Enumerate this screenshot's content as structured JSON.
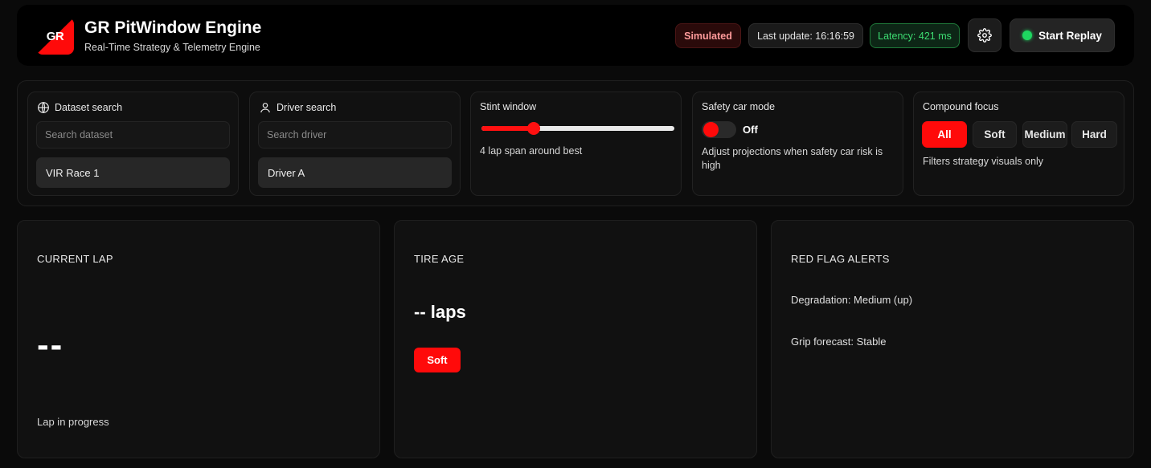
{
  "header": {
    "logo_text": "GR",
    "title": "GR PitWindow Engine",
    "subtitle": "Real-Time Strategy & Telemetry Engine",
    "mode_badge": "Simulated",
    "last_update": "Last update: 16:16:59",
    "latency": "Latency: 421 ms",
    "replay_label": "Start Replay"
  },
  "controls": {
    "dataset": {
      "label": "Dataset search",
      "placeholder": "Search dataset",
      "selected": "VIR Race 1"
    },
    "driver": {
      "label": "Driver search",
      "placeholder": "Search driver",
      "selected": "Driver A"
    },
    "stint": {
      "label": "Stint window",
      "slider_fraction": 0.27,
      "note": "4 lap span around best"
    },
    "safety_car": {
      "label": "Safety car mode",
      "state": "Off",
      "note": "Adjust projections when safety car risk is high"
    },
    "compound": {
      "label": "Compound focus",
      "options": [
        "All",
        "Soft",
        "Medium",
        "Hard"
      ],
      "active": "All",
      "note": "Filters strategy visuals only"
    }
  },
  "cards": {
    "current_lap": {
      "title": "CURRENT LAP",
      "value": "--",
      "footer": "Lap in progress"
    },
    "tire_age": {
      "title": "TIRE AGE",
      "value": "-- laps",
      "compound": "Soft"
    },
    "alerts": {
      "title": "RED FLAG ALERTS",
      "lines": [
        "Degradation: Medium (up)",
        "Grip forecast: Stable"
      ]
    }
  },
  "colors": {
    "accent": "#ff0a0a",
    "latency_green": "#3ddc72",
    "live_dot": "#1ed760"
  }
}
